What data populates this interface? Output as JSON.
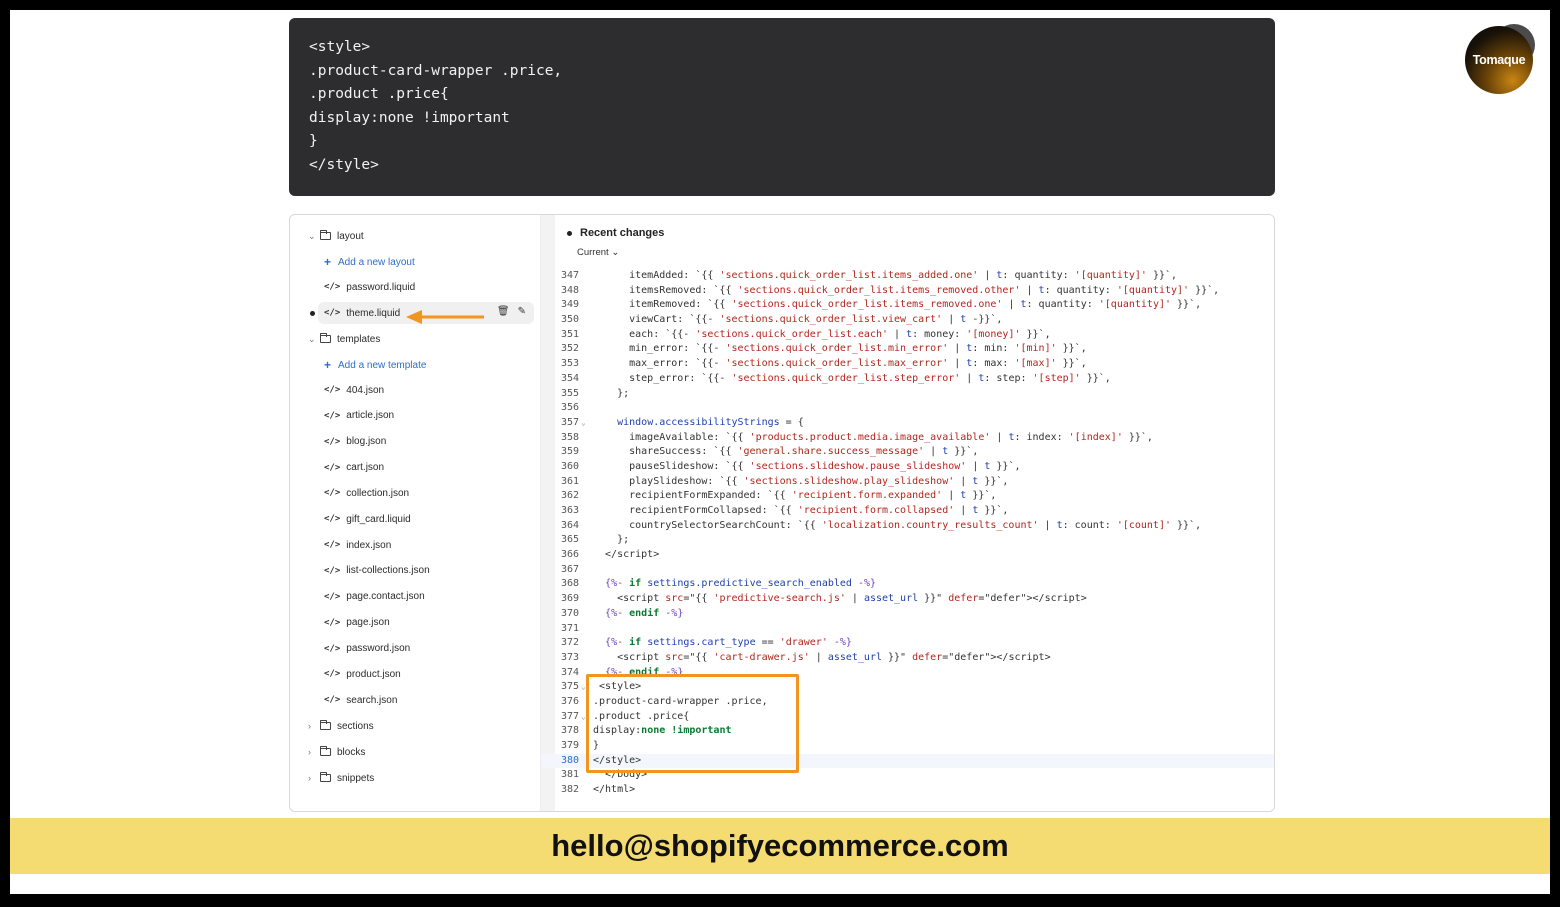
{
  "top_code": [
    "<style>",
    ".product-card-wrapper .price,",
    ".product .price{",
    "display:none !important",
    "}",
    "</style>"
  ],
  "logo": {
    "text": "Tomaque"
  },
  "sidebar": {
    "layout_folder": "layout",
    "add_layout": "Add a new layout",
    "password_liquid": "password.liquid",
    "theme_liquid": "theme.liquid",
    "templates_folder": "templates",
    "add_template": "Add a new template",
    "templates": [
      "404.json",
      "article.json",
      "blog.json",
      "cart.json",
      "collection.json",
      "gift_card.liquid",
      "index.json",
      "list-collections.json",
      "page.contact.json",
      "page.json",
      "password.json",
      "product.json",
      "search.json"
    ],
    "sections_folder": "sections",
    "blocks_folder": "blocks",
    "snippets_folder": "snippets"
  },
  "editor": {
    "recent_changes": "Recent changes",
    "current": "Current ⌄",
    "line_numbers": [
      "347",
      "348",
      "349",
      "350",
      "351",
      "352",
      "353",
      "354",
      "355",
      "356",
      "357",
      "358",
      "359",
      "360",
      "361",
      "362",
      "363",
      "364",
      "365",
      "366",
      "367",
      "368",
      "369",
      "370",
      "371",
      "372",
      "373",
      "374",
      "375",
      "376",
      "377",
      "378",
      "379",
      "380",
      "381",
      "382"
    ],
    "highlighted_line": "380"
  },
  "banner": {
    "email": "hello@shopifyecommerce.com"
  },
  "colors": {
    "accent_orange": "#f0951f",
    "banner_yellow": "#f4db72",
    "code_bg": "#2d2d2f",
    "link_blue": "#2c6ecb"
  }
}
